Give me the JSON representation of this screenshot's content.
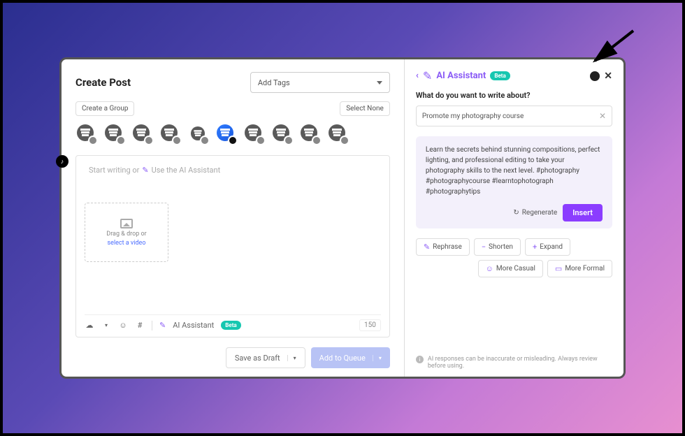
{
  "left": {
    "title": "Create Post",
    "addTags": "Add Tags",
    "createGroup": "Create a Group",
    "selectNone": "Select None",
    "editorPlaceholderPrefix": "Start writing or",
    "editorPlaceholderAction": "Use the AI Assistant",
    "dropzoneLine1": "Drag & drop or",
    "dropzoneLine2": "select a video",
    "aiAssistantLabel": "AI Assistant",
    "betaLabel": "Beta",
    "charCount": "150",
    "saveDraft": "Save as Draft",
    "addQueue": "Add to Queue"
  },
  "right": {
    "title": "AI Assistant",
    "betaLabel": "Beta",
    "question": "What do you want to write about?",
    "prompt": "Promote my photography course",
    "generated": "Learn the secrets behind stunning compositions, perfect lighting, and professional editing to take your photography skills to the next level. #photography #photographycourse #learntophotograph #photographytips",
    "regenerate": "Regenerate",
    "insert": "Insert",
    "tools": {
      "rephrase": "Rephrase",
      "shorten": "Shorten",
      "expand": "Expand",
      "moreCasual": "More Casual",
      "moreFormal": "More Formal"
    },
    "disclaimer": "AI responses can be inaccurate or misleading. Always review before using."
  }
}
